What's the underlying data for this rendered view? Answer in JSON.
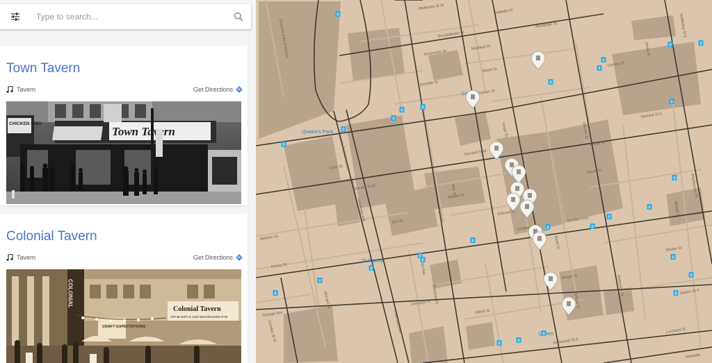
{
  "search": {
    "placeholder": "Type to search..."
  },
  "listings": [
    {
      "title": "Town Tavern",
      "category": "Tavern",
      "directions_label": "Get Directions",
      "sign_text": "Town Tavern",
      "side_sign_text": "CHICKEN RIBS"
    },
    {
      "title": "Colonial Tavern",
      "category": "Tavern",
      "directions_label": "Get Directions",
      "sign_text": "Colonial Tavern",
      "sign_subtext": "ART BLAKEY & JAZZ MESSENGERS GYM",
      "vertical_sign_text": "COLONIAL",
      "banner_text": "CRAFT EXPECTATIONS"
    }
  ],
  "map": {
    "colors": {
      "land": "#dbc6ad",
      "block": "#b8a48d",
      "road": "#3f3a33",
      "minor": "#c8b49c",
      "transit": "#29a7e6"
    },
    "streets": {
      "wellesley": "Wellesley St W",
      "wellesley_e": "Wellesley St E",
      "carlton": "Carlton St",
      "gerrard_w": "Gerrard St W",
      "gerrard_e": "Gerrard St E",
      "dundas_w": "Dundas St W",
      "dundas_e": "Dundas St E",
      "shuter": "Shuter St",
      "queen_e": "Queen St E",
      "richmond": "Richmond St E",
      "adelaide": "Adelaide",
      "elm": "Elm St",
      "edward": "Edward St",
      "walton": "Walton St",
      "wood": "Wood St",
      "grenville": "Grenville St",
      "grosvenor": "Grosvenor St",
      "breadalbane": "Breadalbane St",
      "orde": "Orde St",
      "baldwin": "Baldwin St",
      "darcy": "D'Arcy St",
      "grange": "Grange Ave",
      "mccaul": "McCaul St",
      "armoury": "Armoury St",
      "university": "University Ave",
      "queens_park": "Queen's Park Crescent",
      "yonge": "Yonge St",
      "bay": "Bay St",
      "church": "Church St",
      "jarvis": "Jarvis St",
      "sherbourne": "Sherbourne St",
      "mutual": "Mutual St",
      "dalhousie": "Dalhousie St",
      "victoria": "Victoria St",
      "bond": "Bond St",
      "albert": "Albert St",
      "lombard": "Lombard St",
      "gould": "Gould St",
      "mcgill": "McGill St",
      "alexander": "Alexander St",
      "maitland": "Maitland St",
      "isabella": "Isabella St",
      "hayter": "Hayter St",
      "chestnut": "Chestnut St",
      "centre": "Centre Ave"
    },
    "stations": {
      "college": "College",
      "queens_park": "Queen's Park",
      "st_patrick": "St Patrick",
      "dundas": "Dundas",
      "queen": "Queen"
    },
    "transit_badge": "8",
    "markers": [
      "venue-pin",
      "venue-pin",
      "venue-pin",
      "venue-pin",
      "venue-pin",
      "venue-pin",
      "venue-pin",
      "venue-pin",
      "venue-pin",
      "venue-pin",
      "venue-pin",
      "venue-pin",
      "venue-pin",
      "venue-pin"
    ]
  }
}
